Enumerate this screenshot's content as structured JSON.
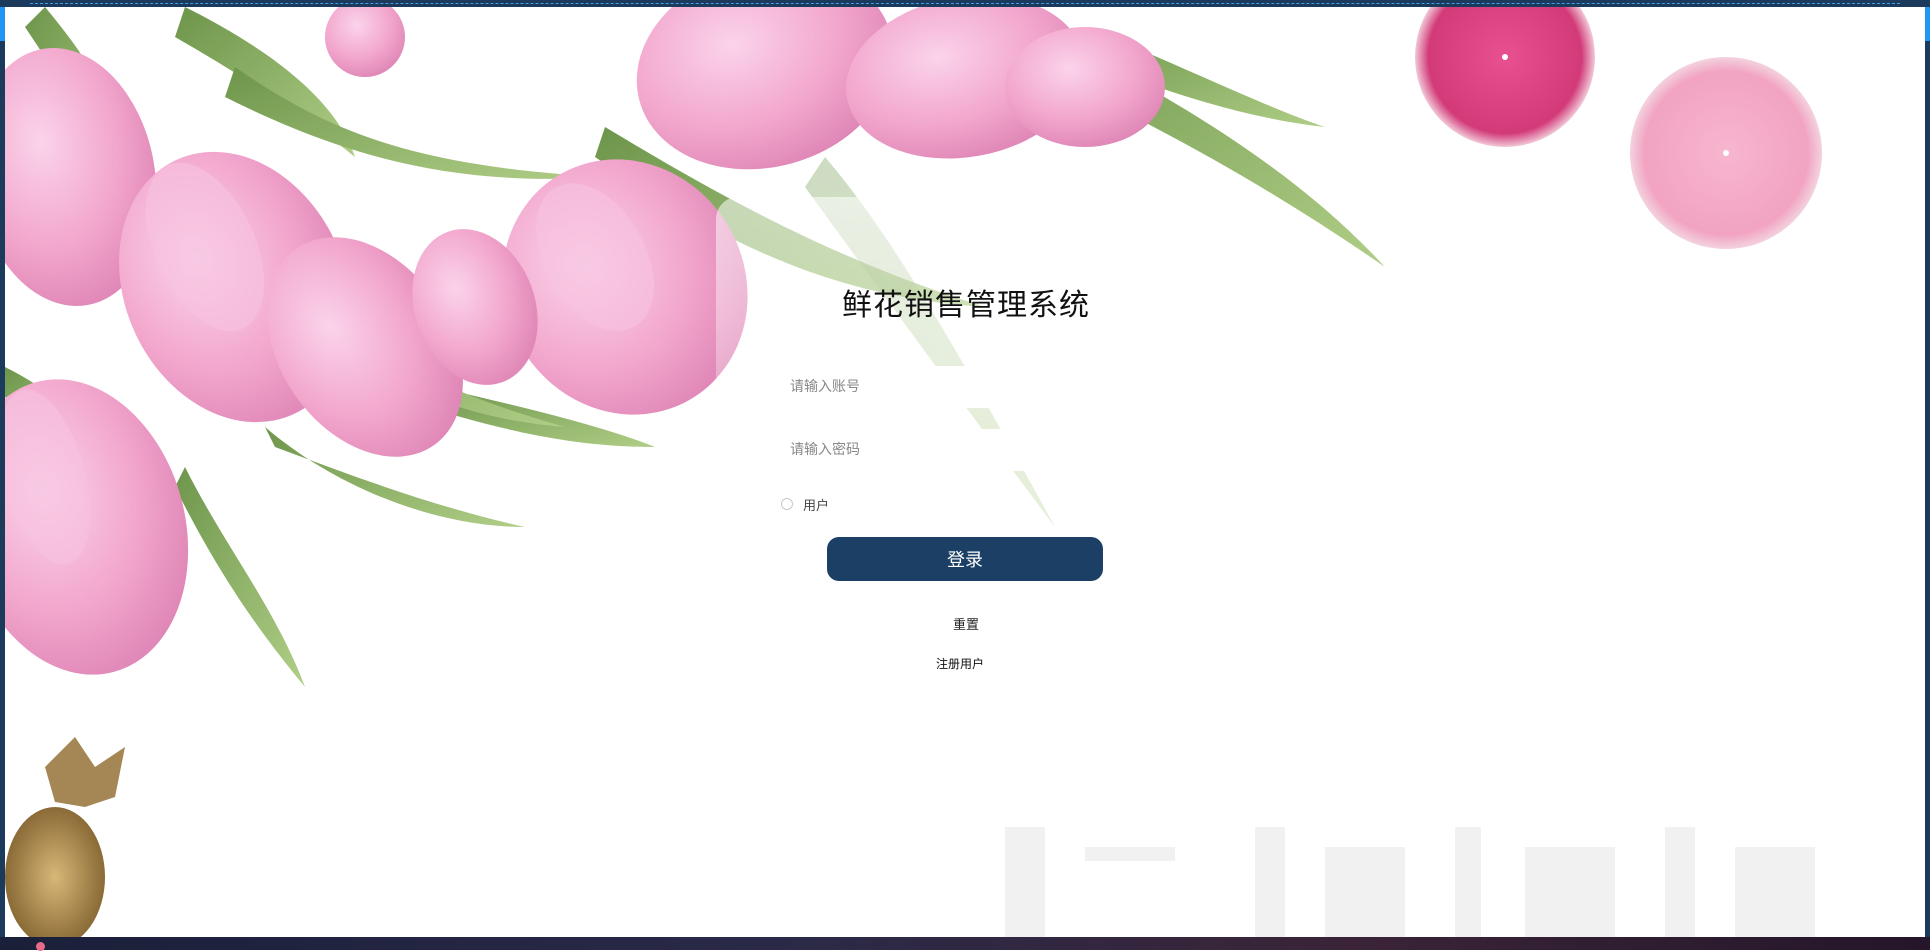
{
  "page": {
    "title": "鲜花销售管理系统"
  },
  "form": {
    "account_placeholder": "请输入账号",
    "password_placeholder": "请输入密码",
    "role_option": "用户",
    "login_label": "登录",
    "reset_label": "重置",
    "register_label": "注册用户"
  },
  "colors": {
    "login_button": "#1c3f65",
    "tulip_pink": "#f3a9cf",
    "leaf_green": "#7aa34a",
    "candle_magenta": "#d63c7a",
    "candle_pink": "#f4aac7"
  }
}
